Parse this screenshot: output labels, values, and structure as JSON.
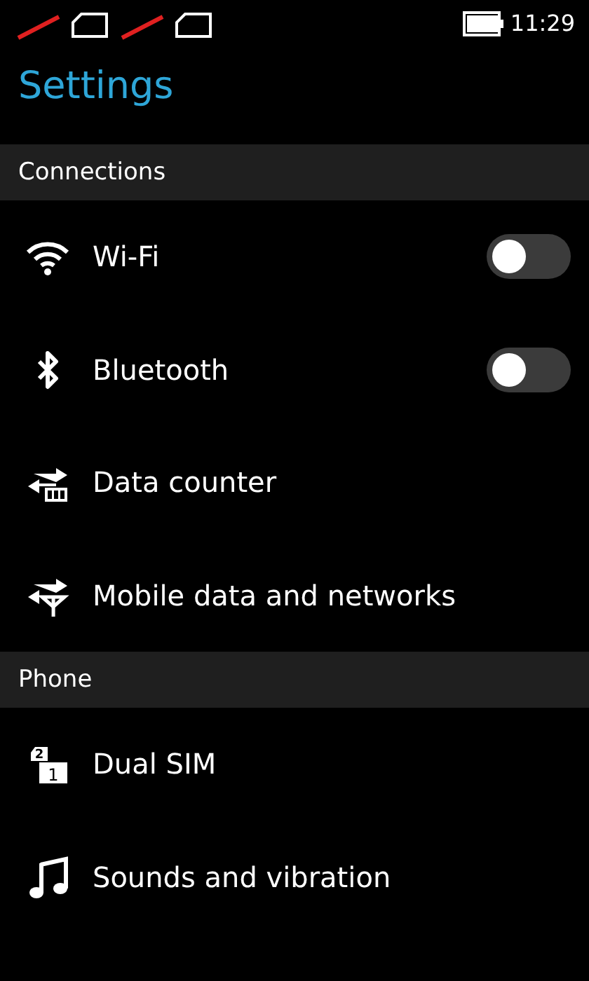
{
  "status_bar": {
    "sims": [
      {
        "no_signal": true
      },
      {
        "no_signal": true
      }
    ],
    "time": "11:29"
  },
  "title": "Settings",
  "sections": [
    {
      "header": "Connections",
      "items": [
        {
          "label": "Wi-Fi",
          "kind": "toggle",
          "on": false
        },
        {
          "label": "Bluetooth",
          "kind": "toggle",
          "on": false
        },
        {
          "label": "Data counter",
          "kind": "link"
        },
        {
          "label": "Mobile data and networks",
          "kind": "link"
        }
      ]
    },
    {
      "header": "Phone",
      "items": [
        {
          "label": "Dual SIM",
          "kind": "link",
          "icon_text": [
            "2",
            "1"
          ]
        },
        {
          "label": "Sounds and vibration",
          "kind": "link"
        }
      ]
    }
  ]
}
